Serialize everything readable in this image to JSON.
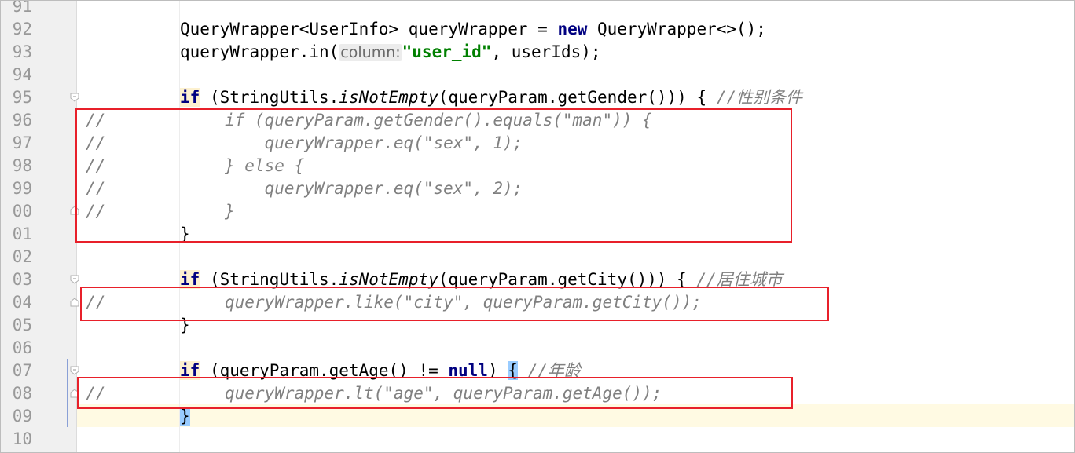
{
  "editor": {
    "current_line": "09",
    "lines": [
      {
        "num": "91",
        "text": ""
      },
      {
        "num": "92",
        "parts": {
          "a": "QueryWrapper<UserInfo> queryWrapper = ",
          "kw": "new",
          "b": " QueryWrapper<>();"
        }
      },
      {
        "num": "93",
        "parts": {
          "a": "queryWrapper.in(",
          "hint": "column:",
          "str": "\"user_id\"",
          "b": ", userIds);"
        }
      },
      {
        "num": "94",
        "text": ""
      },
      {
        "num": "95",
        "parts": {
          "kw": "if",
          "a": " (StringUtils.",
          "it": "isNotEmpty",
          "b": "(queryParam.getGender())) { ",
          "cmt": "//性别条件"
        }
      },
      {
        "num": "96",
        "text": "//            if (queryParam.getGender().equals(\"man\")) {"
      },
      {
        "num": "97",
        "text": "//                queryWrapper.eq(\"sex\", 1);"
      },
      {
        "num": "98",
        "text": "//            } else {"
      },
      {
        "num": "99",
        "text": "//                queryWrapper.eq(\"sex\", 2);"
      },
      {
        "num": "00",
        "text": "//            }"
      },
      {
        "num": "01",
        "text": "}"
      },
      {
        "num": "02",
        "text": ""
      },
      {
        "num": "03",
        "parts": {
          "kw": "if",
          "a": " (StringUtils.",
          "it": "isNotEmpty",
          "b": "(queryParam.getCity())) { ",
          "cmt": "//居住城市"
        }
      },
      {
        "num": "04",
        "text": "//            queryWrapper.like(\"city\", queryParam.getCity());"
      },
      {
        "num": "05",
        "text": "}"
      },
      {
        "num": "06",
        "text": ""
      },
      {
        "num": "07",
        "parts": {
          "kw": "if",
          "a": " (queryParam.getAge() != ",
          "kw2": "null",
          "b": ") ",
          "brace": "{",
          "c": " ",
          "cmt": "//年龄"
        }
      },
      {
        "num": "08",
        "text": "//            queryWrapper.lt(\"age\", queryParam.getAge());"
      },
      {
        "num": "09",
        "text": "}"
      },
      {
        "num": "10",
        "text": ""
      }
    ]
  },
  "colors": {
    "keyword": "#000080",
    "string": "#008000",
    "comment": "#808080",
    "annotation_box": "#e8202a",
    "current_line": "#fffae3",
    "brace_match": "#99ccff"
  }
}
